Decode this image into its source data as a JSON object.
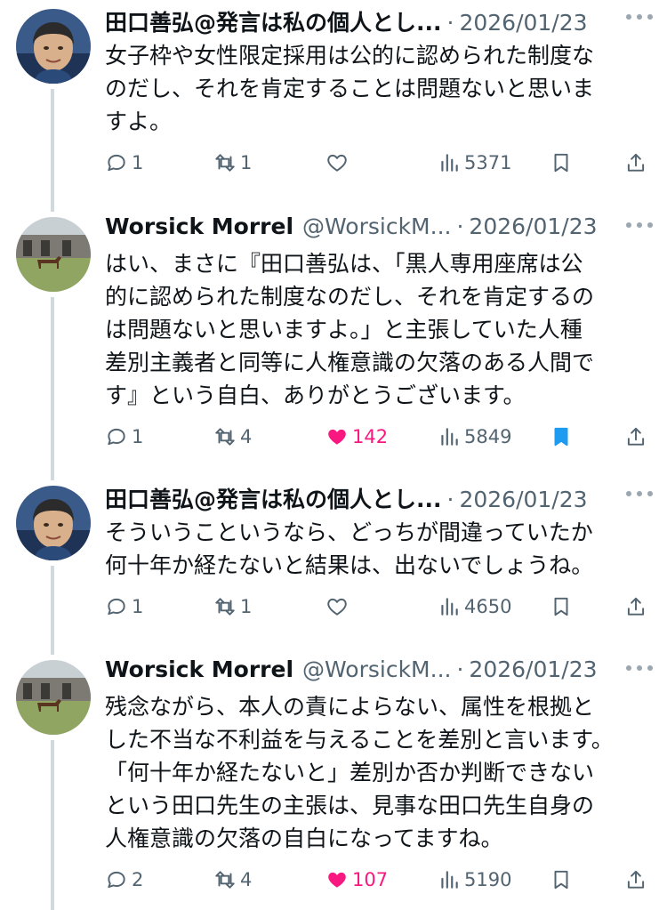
{
  "tweets": [
    {
      "name": "田口善弘@発言は私の個人とし...",
      "handle": "",
      "date": "2026/01/23",
      "avatar": "person-photo-avatar",
      "lines": [
        "女子枠や女性限定採用は公的に認められた制度な",
        "のだし、それを肯定することは問題ないと思いま",
        "すよ。"
      ],
      "replies": "1",
      "retweets": "1",
      "likes": "",
      "liked": false,
      "views": "5371",
      "bookmarked": false
    },
    {
      "name": "Worsick Morrel",
      "handle": "@WorsickM...",
      "date": "2026/01/23",
      "avatar": "horse-photo-avatar",
      "lines": [
        "はい、まさに『田口善弘は、「黒人専用座席は公",
        "的に認められた制度なのだし、それを肯定するの",
        "は問題ないと思いますよ。」と主張していた人種",
        "差別主義者と同等に人権意識の欠落のある人間で",
        "す』という自白、ありがとうございます。"
      ],
      "replies": "1",
      "retweets": "4",
      "likes": "142",
      "liked": true,
      "views": "5849",
      "bookmarked": true
    },
    {
      "name": "田口善弘@発言は私の個人とし...",
      "handle": "",
      "date": "2026/01/23",
      "avatar": "person-photo-avatar",
      "lines": [
        "そういうこというなら、どっちが間違っていたか",
        "何十年か経たないと結果は、出ないでしょうね。"
      ],
      "replies": "1",
      "retweets": "1",
      "likes": "",
      "liked": false,
      "views": "4650",
      "bookmarked": false
    },
    {
      "name": "Worsick Morrel",
      "handle": "@WorsickM...",
      "date": "2026/01/23",
      "avatar": "horse-photo-avatar",
      "lines": [
        "残念ながら、本人の責によらない、属性を根拠と",
        "した不当な不利益を与えることを差別と言います。",
        "「何十年か経たないと」差別か否か判断できない",
        "という田口先生の主張は、見事な田口先生自身の",
        "人権意識の欠落の自白になってますね。"
      ],
      "replies": "2",
      "retweets": "4",
      "likes": "107",
      "liked": true,
      "views": "5190",
      "bookmarked": false
    }
  ],
  "separator": "·",
  "colors": {
    "text": "#0f1419",
    "secondary": "#536471",
    "like": "#f91880",
    "bookmark": "#1d9bf0",
    "thread": "#cfd9de"
  }
}
